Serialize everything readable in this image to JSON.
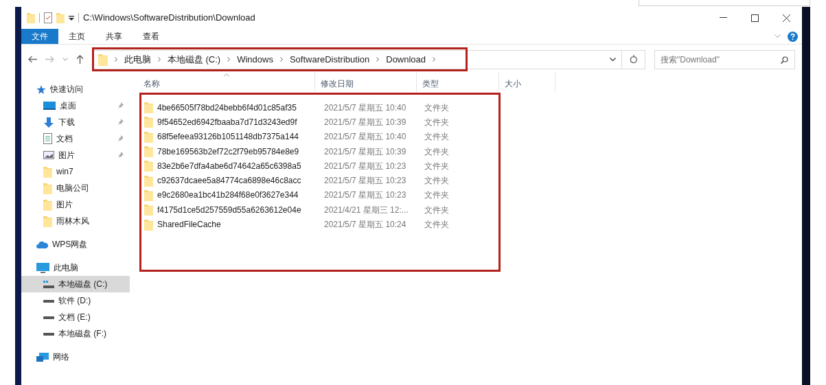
{
  "window": {
    "title": "C:\\Windows\\SoftwareDistribution\\Download"
  },
  "ribbon_tabs": [
    {
      "label": "文件",
      "selected": true
    },
    {
      "label": "主页",
      "selected": false
    },
    {
      "label": "共享",
      "selected": false
    },
    {
      "label": "查看",
      "selected": false
    }
  ],
  "address_bar": {
    "highlighted": true,
    "crumbs": [
      "此电脑",
      "本地磁盘 (C:)",
      "Windows",
      "SoftwareDistribution",
      "Download"
    ]
  },
  "search": {
    "placeholder": "搜索\"Download\""
  },
  "columns": [
    {
      "label": "名称",
      "sorted": true
    },
    {
      "label": "修改日期",
      "sorted": false
    },
    {
      "label": "类型",
      "sorted": false
    },
    {
      "label": "大小",
      "sorted": false
    }
  ],
  "sidebar": [
    {
      "kind": "star",
      "label": "快速访问",
      "selected": false,
      "children": [
        {
          "kind": "desktop",
          "label": "桌面",
          "pinned": true,
          "selected": false
        },
        {
          "kind": "download",
          "label": "下载",
          "pinned": true,
          "selected": false
        },
        {
          "kind": "document",
          "label": "文档",
          "pinned": true,
          "selected": false
        },
        {
          "kind": "image",
          "label": "图片",
          "pinned": true,
          "selected": false
        },
        {
          "kind": "folder",
          "label": "win7",
          "pinned": false,
          "selected": false
        },
        {
          "kind": "folder",
          "label": "电脑公司",
          "pinned": false,
          "selected": false
        },
        {
          "kind": "folder",
          "label": "图片",
          "pinned": false,
          "selected": false
        },
        {
          "kind": "folder",
          "label": "雨林木风",
          "pinned": false,
          "selected": false
        }
      ]
    },
    {
      "kind": "cloud",
      "label": "WPS网盘",
      "selected": false
    },
    {
      "kind": "computer",
      "label": "此电脑",
      "selected": false,
      "children": [
        {
          "kind": "system_drive",
          "label": "本地磁盘 (C:)",
          "pinned": false,
          "selected": true
        },
        {
          "kind": "drive",
          "label": "软件 (D:)",
          "pinned": false,
          "selected": false
        },
        {
          "kind": "drive",
          "label": "文档 (E:)",
          "pinned": false,
          "selected": false
        },
        {
          "kind": "drive",
          "label": "本地磁盘 (F:)",
          "pinned": false,
          "selected": false
        }
      ]
    },
    {
      "kind": "network",
      "label": "网络",
      "selected": false
    }
  ],
  "file_list": {
    "highlighted": true,
    "rows": [
      {
        "name": "4be66505f78bd24bebb6f4d01c85af35",
        "modified": "2021/5/7 星期五 10:40",
        "type": "文件夹"
      },
      {
        "name": "9f54652ed6942fbaaba7d71d3243ed9f",
        "modified": "2021/5/7 星期五 10:39",
        "type": "文件夹"
      },
      {
        "name": "68f5efeea93126b1051148db7375a144",
        "modified": "2021/5/7 星期五 10:40",
        "type": "文件夹"
      },
      {
        "name": "78be169563b2ef72c2f79eb95784e8e9",
        "modified": "2021/5/7 星期五 10:39",
        "type": "文件夹"
      },
      {
        "name": "83e2b6e7dfa4abe6d74642a65c6398a5",
        "modified": "2021/5/7 星期五 10:23",
        "type": "文件夹"
      },
      {
        "name": "c92637dcaee5a84774ca6898e46c8acc",
        "modified": "2021/5/7 星期五 10:23",
        "type": "文件夹"
      },
      {
        "name": "e9c2680ea1bc41b284f68e0f3627e344",
        "modified": "2021/5/7 星期五 10:23",
        "type": "文件夹"
      },
      {
        "name": "f4175d1ce5d257559d55a6263612e04e",
        "modified": "2021/4/21 星期三 12:...",
        "type": "文件夹"
      },
      {
        "name": "SharedFileCache",
        "modified": "2021/5/7 星期五 10:24",
        "type": "文件夹"
      }
    ]
  }
}
